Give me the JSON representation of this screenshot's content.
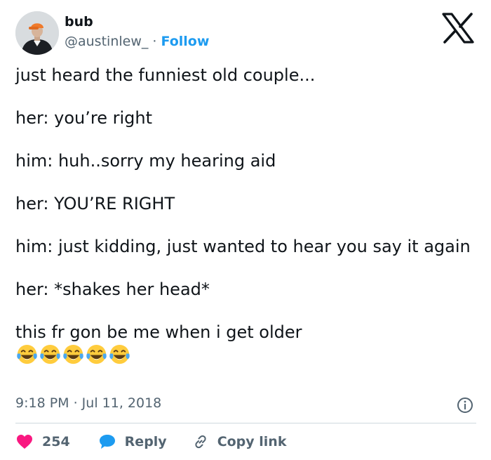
{
  "author": {
    "name": "bub",
    "handle": "@austinlew_",
    "separator": " · ",
    "follow_label": "Follow"
  },
  "icons": {
    "platform_logo": "x-logo-icon",
    "info": "info-icon",
    "like": "heart-icon",
    "reply": "speech-bubble-icon",
    "copy": "link-icon",
    "emoji": "face-with-tears-of-joy"
  },
  "colors": {
    "follow": "#1d9bf0",
    "like_heart": "#f91880",
    "reply_bubble": "#1d9bf0",
    "secondary_text": "#536471"
  },
  "tweet": {
    "lines": [
      "just heard the funniest old couple...",
      "her: you’re right",
      "him: huh..sorry my hearing aid",
      "her: YOU’RE RIGHT",
      "him: just kidding, just wanted to hear you say it again",
      "her: *shakes her head*",
      "this fr gon be me when i get older"
    ],
    "emoji_count": 5,
    "timestamp": "9:18 PM · Jul 11, 2018"
  },
  "actions": {
    "like_count": "254",
    "reply_label": "Reply",
    "copy_link_label": "Copy link"
  }
}
